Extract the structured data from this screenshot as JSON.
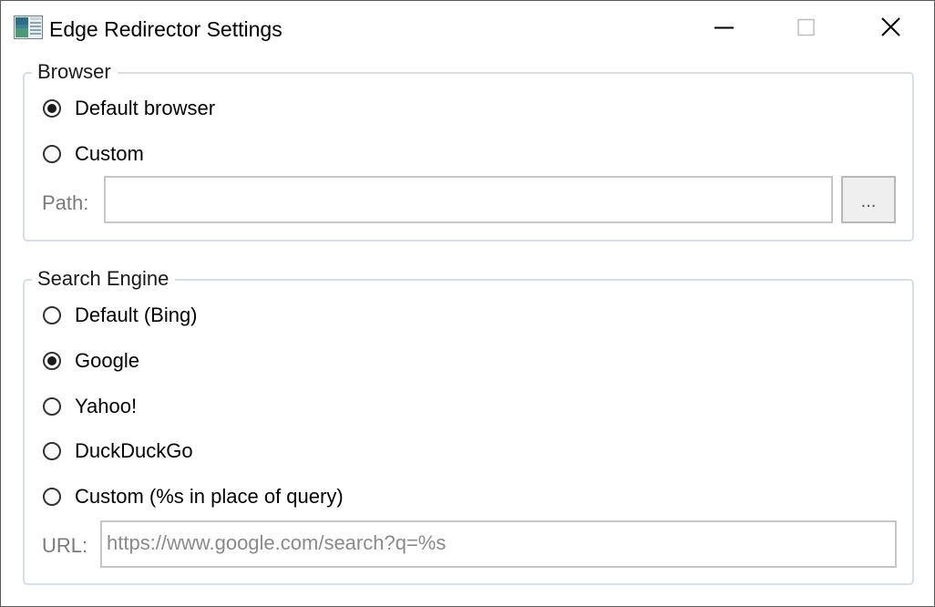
{
  "window": {
    "title": "Edge Redirector Settings",
    "icon": "app-icon",
    "controls": [
      "minimize-icon",
      "maximize-icon",
      "close-icon"
    ]
  },
  "browser_group": {
    "legend": "Browser",
    "options": [
      {
        "label": "Default browser",
        "checked": true
      },
      {
        "label": "Custom",
        "checked": false
      }
    ],
    "path_label": "Path:",
    "path_value": "",
    "browse_label": "..."
  },
  "search_group": {
    "legend": "Search Engine",
    "options": [
      {
        "label": "Default (Bing)",
        "checked": false
      },
      {
        "label": "Google",
        "checked": true
      },
      {
        "label": "Yahoo!",
        "checked": false
      },
      {
        "label": "DuckDuckGo",
        "checked": false
      },
      {
        "label": "Custom (%s in place of query)",
        "checked": false
      }
    ],
    "url_label": "URL:",
    "url_value": "https://www.google.com/search?q=%s"
  }
}
